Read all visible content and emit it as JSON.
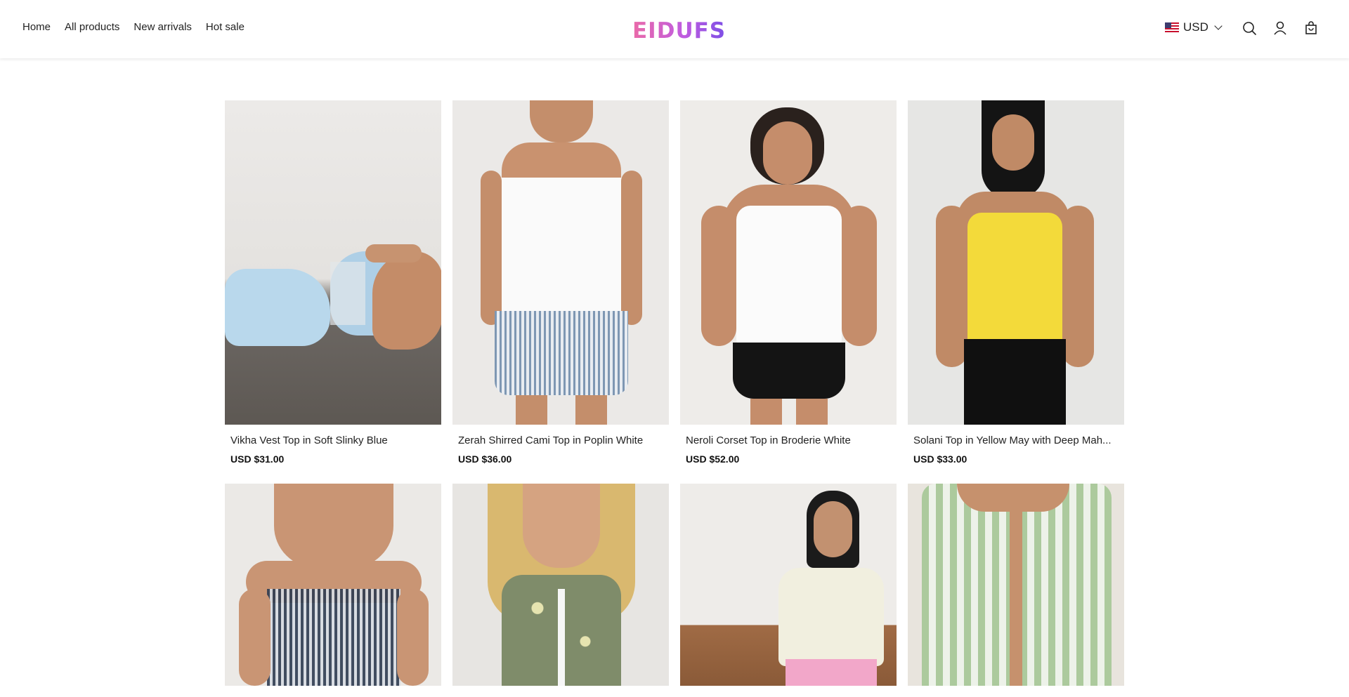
{
  "header": {
    "nav": [
      "Home",
      "All products",
      "New arrivals",
      "Hot sale"
    ],
    "logo": "EIDUFS",
    "currency": "USD",
    "icons": [
      "search-icon",
      "user-icon",
      "cart-icon"
    ]
  },
  "products": [
    {
      "title": "Vikha Vest Top in Soft Slinky Blue",
      "price": "USD $31.00",
      "image": "model-lying-light-blue-vest"
    },
    {
      "title": "Zerah Shirred Cami Top in Poplin White",
      "price": "USD $36.00",
      "image": "model-white-cami-striped-shorts"
    },
    {
      "title": "Neroli Corset Top in Broderie White",
      "price": "USD $52.00",
      "image": "model-white-broderie-corset-black-shorts"
    },
    {
      "title": "Solani Top in Yellow May with Deep Mah...",
      "price": "USD $33.00",
      "image": "model-yellow-cami-black-pants"
    },
    {
      "title": "",
      "price": "",
      "image": "model-strapless-shirred-check-top"
    },
    {
      "title": "",
      "price": "",
      "image": "model-floral-tie-front-top"
    },
    {
      "title": "",
      "price": "",
      "image": "model-cream-sleeveless-top-pink-skirt"
    },
    {
      "title": "",
      "price": "",
      "image": "model-green-check-tie-front-top"
    }
  ],
  "colors": {
    "logo_gradient": [
      "#ea6aa8",
      "#c05ce0",
      "#7d4fe6"
    ],
    "price": "#111111"
  }
}
